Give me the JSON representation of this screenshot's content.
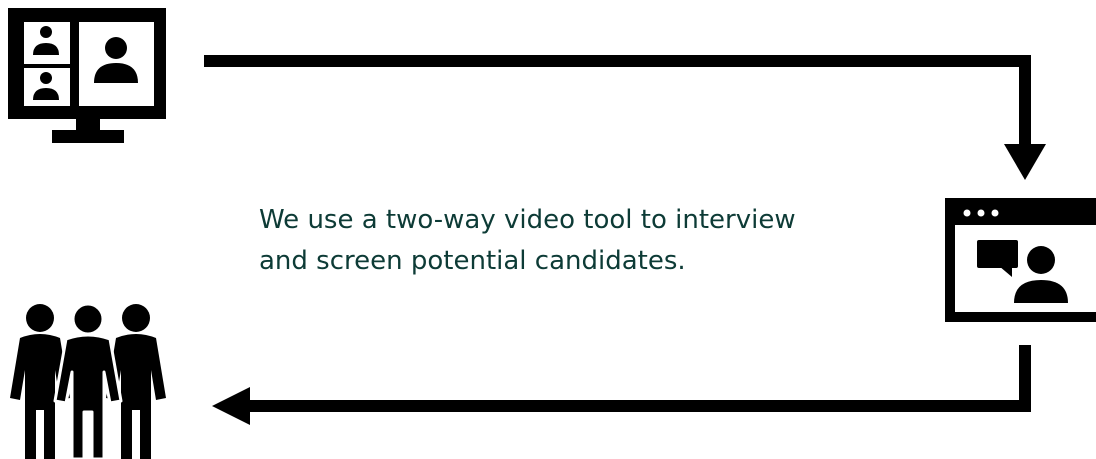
{
  "caption": {
    "lines": [
      "We use a two-way video tool to interview",
      "and screen potential candidates."
    ]
  },
  "colors": {
    "ink": "#000000",
    "text": "#0d3b36",
    "background": "#ffffff"
  },
  "icons": {
    "video_call_monitor": "video-conference-monitor-icon",
    "video_interview_window": "video-interview-window-icon",
    "candidates_group": "people-group-icon"
  }
}
